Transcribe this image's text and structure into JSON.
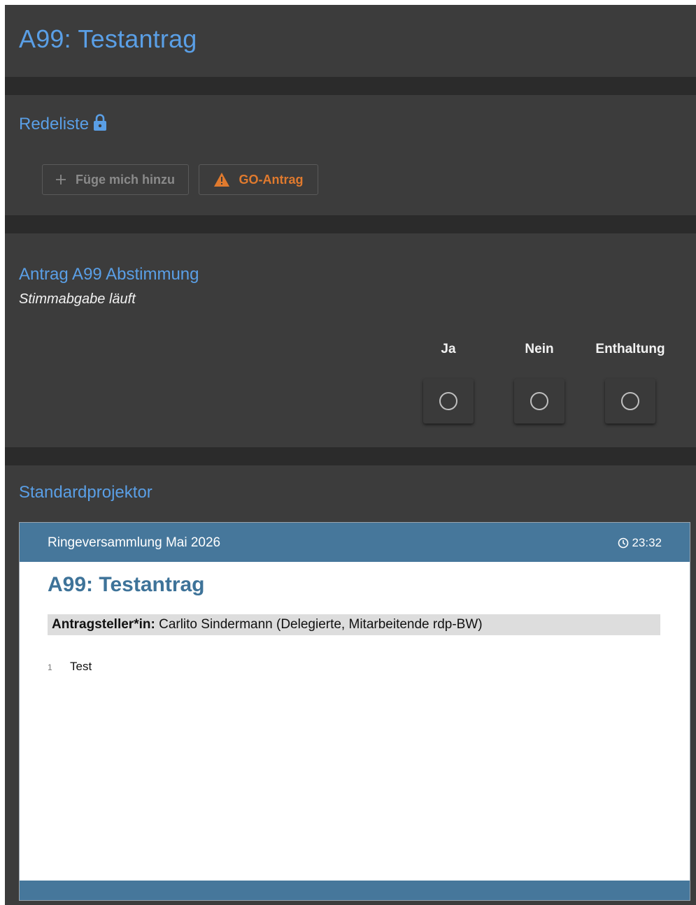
{
  "header": {
    "title": "A99: Testantrag"
  },
  "speakers": {
    "title": "Redeliste",
    "add_label": "Füge mich hinzu",
    "go_label": "GO-Antrag"
  },
  "poll": {
    "title": "Antrag A99 Abstimmung",
    "status": "Stimmabgabe läuft",
    "options": [
      "Ja",
      "Nein",
      "Enthaltung"
    ]
  },
  "projector": {
    "title": "Standardprojektor",
    "event_name": "Ringeversammlung Mai 2026",
    "clock": "23:32",
    "motion_title": "A99: Testantrag",
    "submitter_label": "Antragsteller*in:",
    "submitter_value": "Carlito Sindermann (Delegierte, Mitarbeitende rdp-BW)",
    "line_number": "1",
    "line_text": "Test"
  },
  "colors": {
    "accent_blue": "#5a9fe6",
    "warning_orange": "#e07a2e",
    "projector_header": "#46779b"
  }
}
